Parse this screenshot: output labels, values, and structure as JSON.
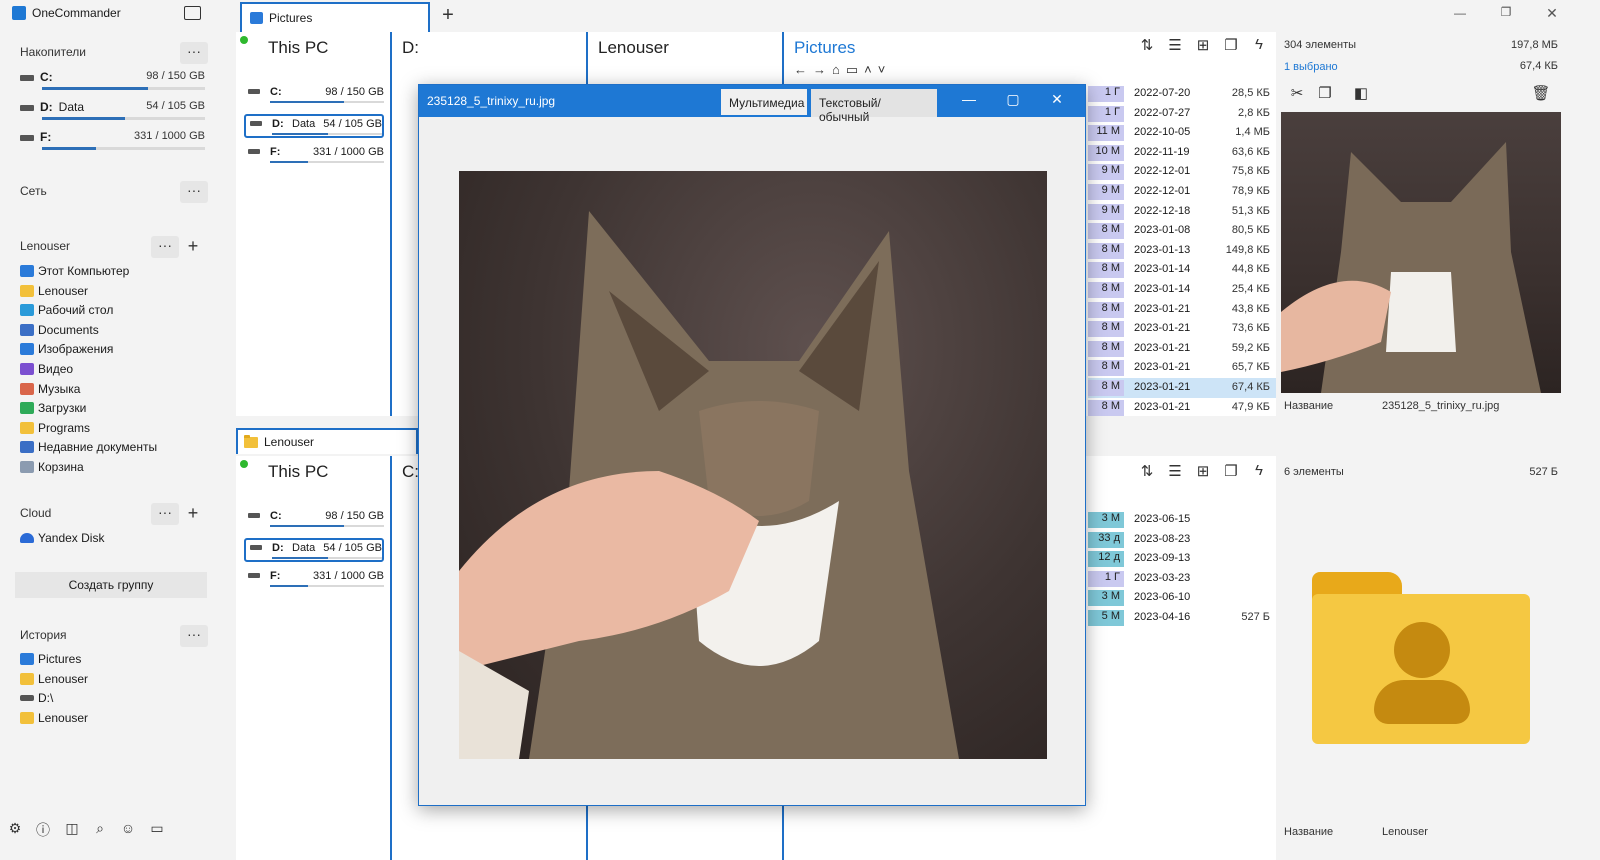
{
  "app": {
    "title": "OneCommander"
  },
  "sidebar": {
    "drives_title": "Накопители",
    "drives": [
      {
        "letter": "C:",
        "label": "",
        "usage": "98 / 150 GB",
        "fill": 0.65
      },
      {
        "letter": "D:",
        "label": "Data",
        "usage": "54 / 105 GB",
        "fill": 0.51
      },
      {
        "letter": "F:",
        "label": "",
        "usage": "331 / 1000 GB",
        "fill": 0.33
      }
    ],
    "network_title": "Сеть",
    "user_title": "Lenouser",
    "user_items": [
      "Этот Компьютер",
      "Lenouser",
      "Рабочий стол",
      "Documents",
      "Изображения",
      "Видео",
      "Музыка",
      "Загрузки",
      "Programs",
      "Недавние документы",
      "Корзина"
    ],
    "cloud_title": "Cloud",
    "cloud_items": [
      "Yandex Disk"
    ],
    "create_group": "Создать группу",
    "history_title": "История",
    "history_items": [
      "Pictures",
      "Lenouser",
      "D:\\",
      "Lenouser"
    ]
  },
  "tabs": [
    {
      "label": "Pictures"
    }
  ],
  "pane_top": {
    "col1_title": "This PC",
    "col2_title": "D:",
    "col3_title": "Lenouser",
    "col4_title": "Pictures",
    "drives": [
      {
        "letter": "C:",
        "label": "",
        "usage": "98 / 150 GB",
        "fill": 0.65
      },
      {
        "letter": "D:",
        "label": "Data",
        "usage": "54 / 105 GB",
        "fill": 0.51
      },
      {
        "letter": "F:",
        "label": "",
        "usage": "331 / 1000 GB",
        "fill": 0.33
      }
    ],
    "files": [
      {
        "age": "1 Г",
        "date": "2022-07-20",
        "size": "28,5 КБ"
      },
      {
        "age": "1 Г",
        "date": "2022-07-27",
        "size": "2,8 КБ"
      },
      {
        "age": "11 М",
        "date": "2022-10-05",
        "size": "1,4 МБ"
      },
      {
        "age": "10 М",
        "date": "2022-11-19",
        "size": "63,6 КБ"
      },
      {
        "age": "9 М",
        "date": "2022-12-01",
        "size": "75,8 КБ"
      },
      {
        "age": "9 М",
        "date": "2022-12-01",
        "size": "78,9 КБ"
      },
      {
        "age": "9 М",
        "date": "2022-12-18",
        "size": "51,3 КБ"
      },
      {
        "age": "8 М",
        "date": "2023-01-08",
        "size": "80,5 КБ"
      },
      {
        "age": "8 М",
        "date": "2023-01-13",
        "size": "149,8 КБ"
      },
      {
        "age": "8 М",
        "date": "2023-01-14",
        "size": "44,8 КБ"
      },
      {
        "age": "8 М",
        "date": "2023-01-14",
        "size": "25,4 КБ"
      },
      {
        "age": "8 М",
        "date": "2023-01-21",
        "size": "43,8 КБ"
      },
      {
        "age": "8 М",
        "date": "2023-01-21",
        "size": "73,6 КБ"
      },
      {
        "age": "8 М",
        "date": "2023-01-21",
        "size": "59,2 КБ"
      },
      {
        "age": "8 М",
        "date": "2023-01-21",
        "size": "65,7 КБ"
      },
      {
        "age": "8 М",
        "date": "2023-01-21",
        "size": "67,4 КБ"
      },
      {
        "age": "8 М",
        "date": "2023-01-21",
        "size": "47,9 КБ"
      }
    ],
    "info_count": "304 элементы",
    "info_total": "197,8 МБ",
    "info_selected": "1 выбрано",
    "info_selected_size": "67,4 КБ",
    "name_label": "Название",
    "name_value": "235128_5_trinixy_ru.jpg"
  },
  "pane_bottom": {
    "tab_label": "Lenouser",
    "col1_title": "This PC",
    "col2_title": "C:",
    "drives": [
      {
        "letter": "C:",
        "label": "",
        "usage": "98 / 150 GB",
        "fill": 0.65
      },
      {
        "letter": "D:",
        "label": "Data",
        "usage": "54 / 105 GB",
        "fill": 0.51
      },
      {
        "letter": "F:",
        "label": "",
        "usage": "331 / 1000 GB",
        "fill": 0.33
      }
    ],
    "files": [
      {
        "age": "3 М",
        "date": "2023-06-15",
        "size": ""
      },
      {
        "age": "33 д",
        "date": "2023-08-23",
        "size": ""
      },
      {
        "age": "12 д",
        "date": "2023-09-13",
        "size": ""
      },
      {
        "age": "1 Г",
        "date": "2023-03-23",
        "size": ""
      },
      {
        "age": "3 М",
        "date": "2023-06-10",
        "size": ""
      },
      {
        "age": "5 М",
        "date": "2023-04-16",
        "size": "527 Б"
      }
    ],
    "info_count": "6 элементы",
    "info_total": "527 Б",
    "name_label": "Название",
    "name_value": "Lenouser"
  },
  "viewer": {
    "filename": "235128_5_trinixy_ru.jpg",
    "tab_media": "Мультимедиа",
    "tab_text": "Текстовый/обычный"
  },
  "colors": {
    "accent": "#1e78d4",
    "age_new": "#7fc8d8",
    "age_old": "#c9c9f0",
    "selected": "#cde4f7"
  }
}
